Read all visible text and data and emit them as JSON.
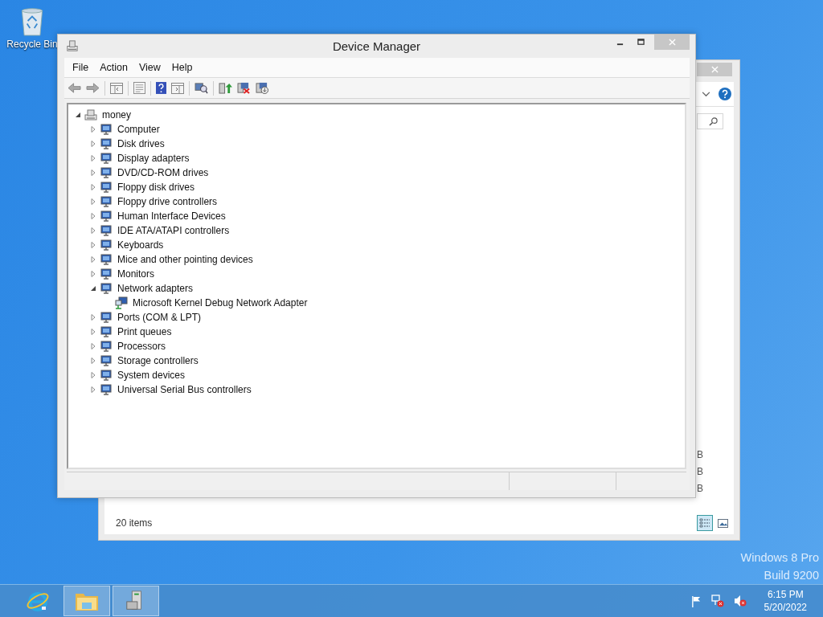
{
  "desktop_icons": [
    {
      "label": "Recycle Bin"
    }
  ],
  "background_window": {
    "column_fragments": [
      "B",
      "B",
      "B"
    ],
    "status": "20 items",
    "views": [
      {
        "selected": true
      },
      {
        "selected": false
      }
    ]
  },
  "window": {
    "title": "Device Manager"
  },
  "menu": [
    "File",
    "Action",
    "View",
    "Help"
  ],
  "tree": {
    "label": "money",
    "expanded": true,
    "children": [
      {
        "label": "Computer",
        "expanded": false
      },
      {
        "label": "Disk drives",
        "expanded": false
      },
      {
        "label": "Display adapters",
        "expanded": false
      },
      {
        "label": "DVD/CD-ROM drives",
        "expanded": false
      },
      {
        "label": "Floppy disk drives",
        "expanded": false
      },
      {
        "label": "Floppy drive controllers",
        "expanded": false
      },
      {
        "label": "Human Interface Devices",
        "expanded": false
      },
      {
        "label": "IDE ATA/ATAPI controllers",
        "expanded": false
      },
      {
        "label": "Keyboards",
        "expanded": false
      },
      {
        "label": "Mice and other pointing devices",
        "expanded": false
      },
      {
        "label": "Monitors",
        "expanded": false
      },
      {
        "label": "Network adapters",
        "expanded": true,
        "children": [
          {
            "label": "Microsoft Kernel Debug Network Adapter"
          }
        ]
      },
      {
        "label": "Ports (COM & LPT)",
        "expanded": false
      },
      {
        "label": "Print queues",
        "expanded": false
      },
      {
        "label": "Processors",
        "expanded": false
      },
      {
        "label": "Storage controllers",
        "expanded": false
      },
      {
        "label": "System devices",
        "expanded": false
      },
      {
        "label": "Universal Serial Bus controllers",
        "expanded": false
      }
    ]
  },
  "os_version": [
    "Windows 8 Pro",
    "Build 9200"
  ],
  "taskbar": {
    "apps": [
      {
        "kind": "browser",
        "running": false
      },
      {
        "kind": "files",
        "running": true
      },
      {
        "kind": "devices",
        "running": true
      }
    ]
  },
  "clock": {
    "time": "6:15 PM",
    "date": "5/20/2022"
  }
}
